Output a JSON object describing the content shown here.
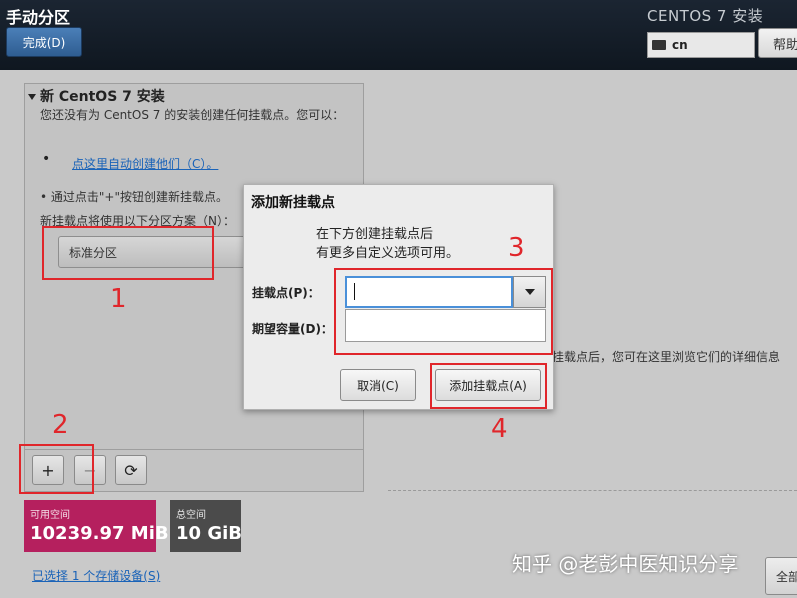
{
  "header": {
    "title": "手动分区",
    "done_label": "完成(D)",
    "os_title": "CENTOS 7 安装",
    "keyboard_layout": "cn",
    "help_label": "帮助"
  },
  "left_panel": {
    "install_title": "新 CentOS 7 安装",
    "description": "您还没有为 CentOS 7 的安装创建任何挂载点。您可以：",
    "bullet_symbol": "•",
    "auto_create_link": "点这里自动创建他们（C）。",
    "manual_hint": "• 通过点击\"+\"按钮创建新挂载点。",
    "scheme_label": "新挂载点将使用以下分区方案（N）：",
    "scheme_value": "标准分区",
    "toolbar": {
      "add_symbol": "+",
      "remove_symbol": "−",
      "refresh_symbol": "⟳"
    }
  },
  "space": {
    "available_label": "可用空间",
    "available_value": "10239.97 MiB",
    "total_label": "总空间",
    "total_value": "10 GiB"
  },
  "storage_link": "已选择 1 个存储设备(S)",
  "right_hint": "挂载点后，您可在这里浏览它们的详细信息",
  "reset_label": "全部重设",
  "dialog": {
    "title": "添加新挂载点",
    "description_line1": "在下方创建挂载点后",
    "description_line2": "有更多自定义选项可用。",
    "mount_label": "挂载点(P)：",
    "mount_value": "",
    "capacity_label": "期望容量(D)：",
    "capacity_value": "",
    "cancel_label": "取消(C)",
    "add_label": "添加挂载点(A)"
  },
  "annotations": {
    "n1": "1",
    "n2": "2",
    "n3": "3",
    "n4": "4",
    "color": "#e0262b"
  },
  "watermark": "知乎 @老彭中医知识分享",
  "colors": {
    "header_bg": "#141e2a",
    "accent_blue": "#3a6ea5",
    "available_tile": "#b5205e",
    "total_tile": "#4b4b4b",
    "link": "#1a63b8"
  },
  "icons": {
    "keyboard": "keyboard-icon",
    "dropdown": "chevron-down-icon",
    "collapse": "collapse-triangle-icon",
    "refresh": "refresh-icon"
  }
}
